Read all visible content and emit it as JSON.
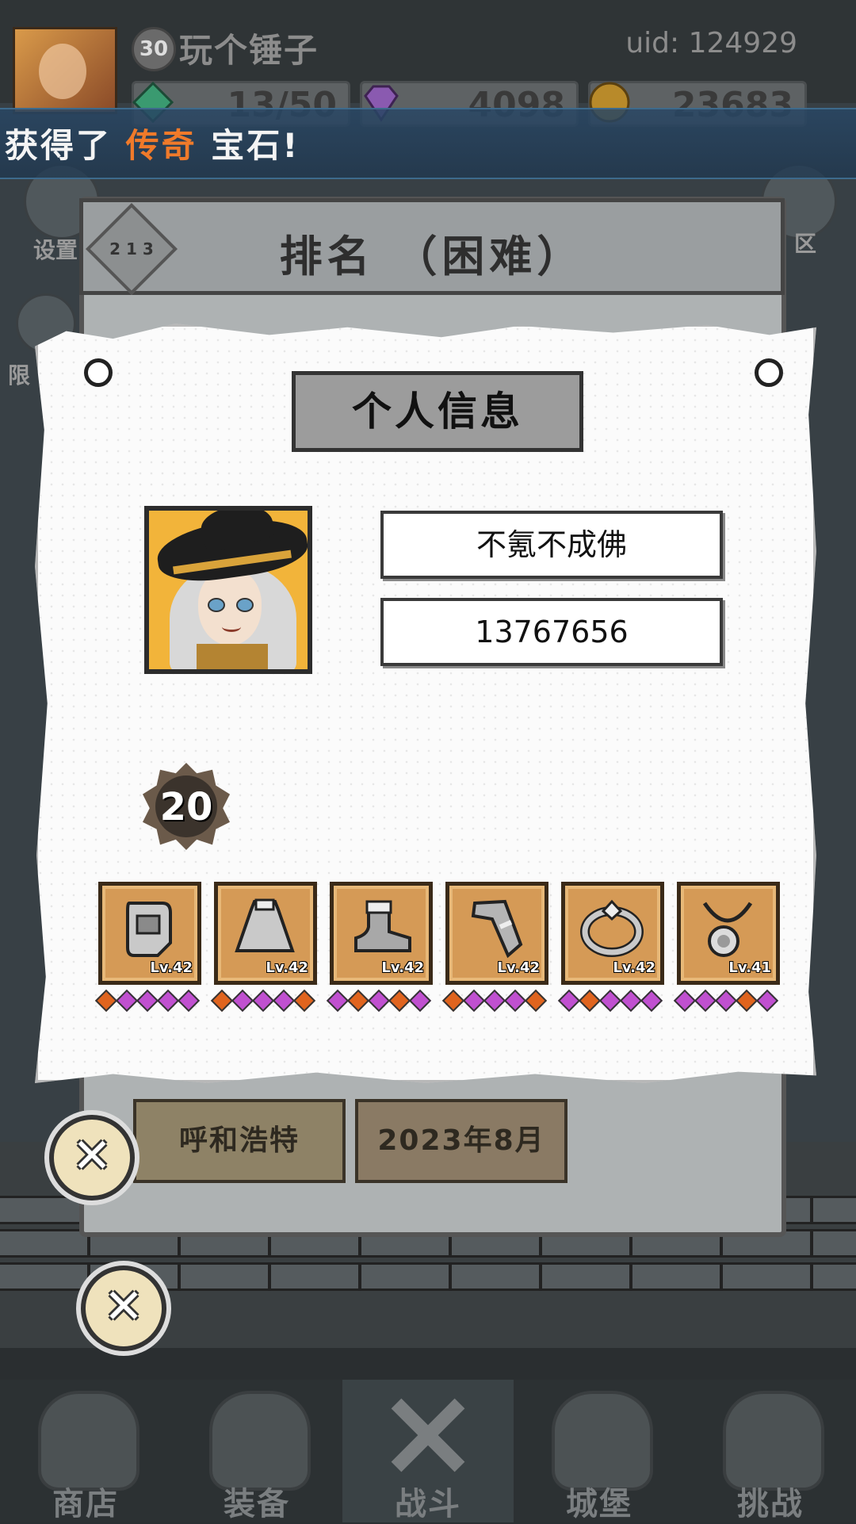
{
  "topbar": {
    "player_level": "30",
    "player_name": "玩个锤子",
    "uid": "uid: 124929",
    "stamina": "13/50",
    "gems": "4098",
    "gold": "23683"
  },
  "banner": {
    "prefix": "获得了 ",
    "highlight": "传奇",
    "suffix": " 宝石!"
  },
  "side": {
    "settings_label": "设置",
    "limited_label": "限",
    "server_label": "区"
  },
  "rank_panel": {
    "title": "排名 （困难）",
    "rank_icon_text": "2 1 3",
    "city_button": "呼和浩特",
    "date_button": "2023年8月"
  },
  "profile": {
    "section_title": "个人信息",
    "player_name": "不氪不成佛",
    "score": "13767656",
    "level": "20",
    "equipment": [
      {
        "icon": "helmet-icon",
        "level": "Lv.42",
        "pips": [
          "o",
          "p",
          "p",
          "p",
          "p"
        ]
      },
      {
        "icon": "cape-icon",
        "level": "Lv.42",
        "pips": [
          "o",
          "p",
          "p",
          "p",
          "o"
        ]
      },
      {
        "icon": "boots-icon",
        "level": "Lv.42",
        "pips": [
          "p",
          "o",
          "p",
          "o",
          "p"
        ]
      },
      {
        "icon": "bracer-icon",
        "level": "Lv.42",
        "pips": [
          "o",
          "p",
          "p",
          "p",
          "o"
        ]
      },
      {
        "icon": "ring-icon",
        "level": "Lv.42",
        "pips": [
          "p",
          "o",
          "p",
          "p",
          "p"
        ]
      },
      {
        "icon": "amulet-icon",
        "level": "Lv.41",
        "pips": [
          "p",
          "p",
          "p",
          "o",
          "p"
        ]
      }
    ]
  },
  "nav": {
    "items": [
      "商店",
      "装备",
      "战斗",
      "城堡",
      "挑战"
    ],
    "active": "战斗"
  },
  "colors": {
    "legendary": "#f07a2a",
    "pip_orange": "#e0641e",
    "pip_purple": "#c050d0"
  }
}
